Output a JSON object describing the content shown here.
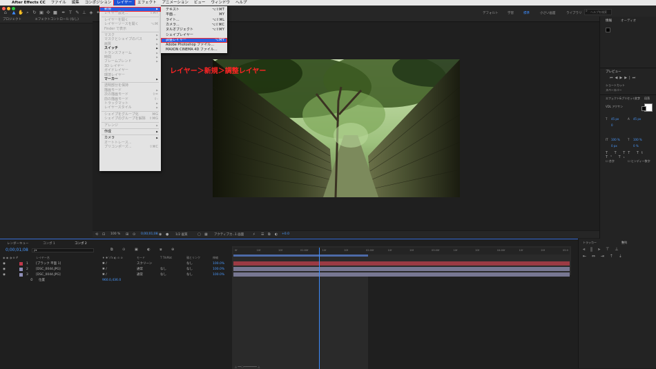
{
  "menubar": {
    "apple": "",
    "items": [
      "After Effects CC",
      "ファイル",
      "編集",
      "コンポジション",
      "レイヤー",
      "エフェクト",
      "アニメーション",
      "ビュー",
      "ウィンドウ",
      "ヘルプ"
    ],
    "selected": "レイヤー"
  },
  "workspaces": [
    "デフォルト",
    "学習",
    "標準",
    "小さい画面",
    "ライブラリ"
  ],
  "workspace_selected": "標準",
  "search_placeholder": "ヘルプを検索",
  "panels": {
    "project_tab": "プロジェクト",
    "effect_controls_tab": "エフェクトコントロール (なし)",
    "info_tab": "情報",
    "audio_tab": "オーディオ",
    "preview_tab": "プレビュー",
    "shortcut_label": "ショートカット",
    "shortcut_value": "スペースバー",
    "effects_presets_tab": "エフェクト&プリセット",
    "character_tab": "文字",
    "paragraph_tab": "段落",
    "align_tab": "整列",
    "tracker_tab": "トラッカー",
    "font_value": "VDL アクサン",
    "font_size": "45 px",
    "leading": "45 px",
    "tracking": "0",
    "scale_h": "100 %",
    "scale_v": "100 %",
    "baseline": "0 px",
    "tsume": "0 %",
    "check_hindi": "合字",
    "check_hindi2": "ヒンディー数字"
  },
  "layer_menu": {
    "items": [
      {
        "label": "新規",
        "arrow": true,
        "highlight": true
      },
      {
        "label": "レイヤー設定...",
        "shortcut": "⇧⌘Y",
        "disabled": true
      },
      {
        "sep": true
      },
      {
        "label": "レイヤーを開く",
        "disabled": true
      },
      {
        "label": "レイヤーソースを開く",
        "shortcut": "⌥⌘",
        "disabled": true
      },
      {
        "label": "Finder で表示",
        "disabled": true
      },
      {
        "sep": true
      },
      {
        "label": "マスク",
        "arrow": true,
        "disabled": true
      },
      {
        "label": "マスクとシェイプのパス",
        "arrow": true,
        "disabled": true
      },
      {
        "label": "画質",
        "arrow": true,
        "disabled": true
      },
      {
        "label": "スイッチ",
        "arrow": true,
        "bold": true
      },
      {
        "label": "トランスフォーム",
        "arrow": true,
        "disabled": true
      },
      {
        "label": "時間",
        "arrow": true,
        "disabled": true
      },
      {
        "label": "フレームブレンド",
        "arrow": true,
        "disabled": true
      },
      {
        "label": "3D レイヤー",
        "disabled": true
      },
      {
        "label": "ガイドレイヤー",
        "disabled": true
      },
      {
        "label": "環境レイヤー",
        "disabled": true
      },
      {
        "label": "マーカー",
        "arrow": true,
        "bold": true
      },
      {
        "sep": true
      },
      {
        "label": "透明部分を保持",
        "disabled": true
      },
      {
        "label": "描画モード",
        "arrow": true,
        "disabled": true
      },
      {
        "label": "次の描画モード",
        "shortcut": "⇧=",
        "disabled": true
      },
      {
        "label": "前の描画モード",
        "shortcut": "⇧-",
        "disabled": true
      },
      {
        "label": "トラックマット",
        "arrow": true,
        "disabled": true
      },
      {
        "label": "レイヤースタイル",
        "arrow": true,
        "disabled": true
      },
      {
        "sep": true
      },
      {
        "label": "シェイプをグループ化",
        "shortcut": "⌘G",
        "disabled": true
      },
      {
        "label": "シェイプのグループを解除",
        "shortcut": "⇧⌘G",
        "disabled": true
      },
      {
        "sep": true
      },
      {
        "label": "アレンジ",
        "arrow": true,
        "disabled": true
      },
      {
        "sep": true
      },
      {
        "label": "作成",
        "arrow": true,
        "bold": false
      },
      {
        "sep": true
      },
      {
        "label": "カメラ",
        "arrow": true
      },
      {
        "label": "オートトレース...",
        "disabled": true
      },
      {
        "label": "プリコンポーズ...",
        "shortcut": "⇧⌘C",
        "disabled": true
      }
    ]
  },
  "new_submenu": {
    "items": [
      {
        "label": "テキスト",
        "shortcut": "⌥⇧⌘T"
      },
      {
        "label": "平面...",
        "shortcut": "⌘Y"
      },
      {
        "label": "ライト...",
        "shortcut": "⌥⇧⌘L"
      },
      {
        "label": "カメラ...",
        "shortcut": "⌥⇧⌘C"
      },
      {
        "label": "ヌルオブジェクト",
        "shortcut": "⌥⇧⌘Y"
      },
      {
        "label": "シェイプレイヤー"
      },
      {
        "label": "調整レイヤー",
        "shortcut": "⌥⌘Y",
        "highlight": true
      },
      {
        "label": "Adobe Photoshop ファイル..."
      },
      {
        "label": "MAXON CINEMA 4D ファイル..."
      }
    ]
  },
  "caption": "レイヤー＞新規＞調整レイヤー",
  "viewer_bar": {
    "zoom": "100 %",
    "timecode": "0;00;01;08",
    "resolution": "1/2 画質",
    "camera": "アクティブカ...",
    "views": "1 画面",
    "offset": "+0.0"
  },
  "timeline": {
    "tabs": [
      "レンダーキュー",
      "コンポ 1",
      "コンポ 2"
    ],
    "timecode": "0;00;01;08",
    "search_placeholder": "ρ▾",
    "headers": {
      "name": "レイヤー名",
      "mode": "モード",
      "trkmat": "T TrkMat",
      "parent": "親とリンク",
      "stretch": "伸縮"
    },
    "layers": [
      {
        "num": "1",
        "name": "[ブラック 平面 1]",
        "mode": "スクリーン",
        "trk": "",
        "parent": "なし",
        "stretch": "100.0%",
        "color": "#c0394b"
      },
      {
        "num": "2",
        "name": "[DSC_0044.JPG]",
        "mode": "通常",
        "trk": "なし",
        "parent": "なし",
        "stretch": "100.0%",
        "color": "#8f8fb8"
      },
      {
        "num": "3",
        "name": "[DSC_0044.JPG]",
        "mode": "通常",
        "trk": "なし",
        "parent": "なし",
        "stretch": "100.0%",
        "color": "#8f8fb8"
      }
    ],
    "sublayer_label": "位置",
    "sublayer_value": "960.0,436.0",
    "ruler": [
      "0f",
      "10f",
      "20f",
      "01:00f",
      "10f",
      "20f",
      "02:00f",
      "10f",
      "20f",
      "03:00f",
      "10f",
      "20f",
      "04:00f",
      "10f",
      "20f",
      "05:0"
    ],
    "playhead_fraction": 0.255
  }
}
